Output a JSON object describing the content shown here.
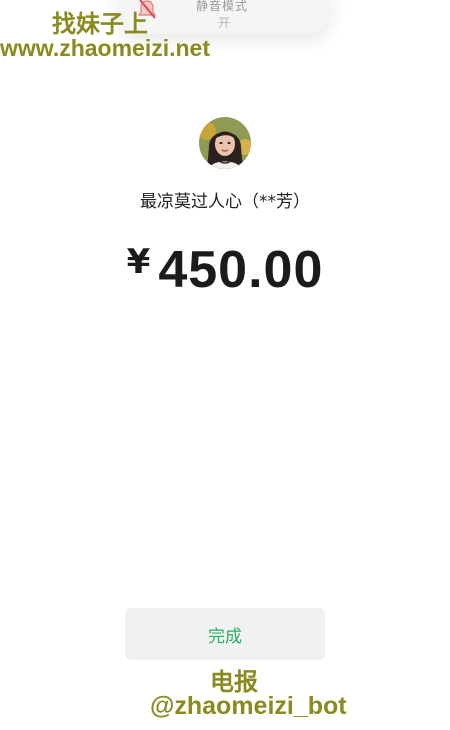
{
  "toast": {
    "title": "静音模式",
    "state": "开",
    "icon": "bell-silent-icon"
  },
  "watermark": {
    "top_text": "找妹子上",
    "top_url": "www.zhaomeizi.net",
    "bottom_text": "电报",
    "bottom_handle": "@zhaomeizi_bot"
  },
  "payment": {
    "payee": "最凉莫过人心（**芳）",
    "currency_symbol": "¥",
    "amount": "450.00"
  },
  "actions": {
    "done_label": "完成"
  },
  "colors": {
    "accent": "#2aae67",
    "watermark": "#8a8a1e",
    "button_bg": "#f1f1f1",
    "text": "#1b1b1b"
  }
}
